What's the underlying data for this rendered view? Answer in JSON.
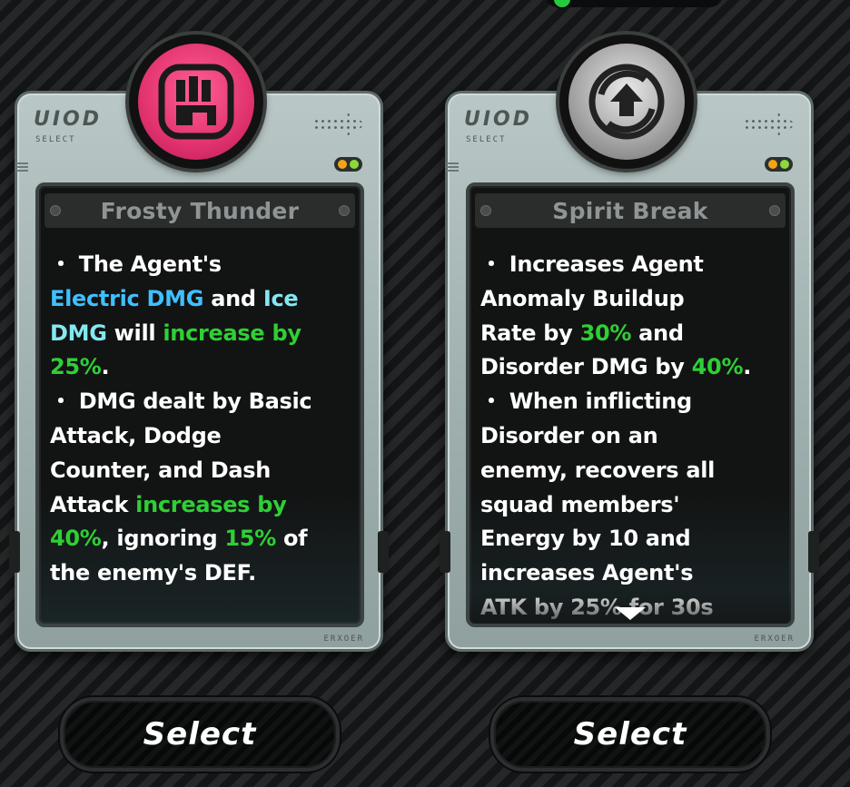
{
  "cards": [
    {
      "brand": "UIOD",
      "brand_sub": "SELECT",
      "foot_code": "ERXOER",
      "icon": "pink-fist-emblem-icon",
      "title": "Frosty Thunder",
      "lines": [
        [
          {
            "t": "・ The Agent's",
            "c": "white"
          }
        ],
        [
          {
            "t": "Electric DMG",
            "c": "blue"
          },
          {
            "t": " and ",
            "c": "white"
          },
          {
            "t": "Ice",
            "c": "ice"
          }
        ],
        [
          {
            "t": "DMG",
            "c": "ice"
          },
          {
            "t": " will ",
            "c": "white"
          },
          {
            "t": "increase by",
            "c": "green"
          }
        ],
        [
          {
            "t": "25%",
            "c": "green"
          },
          {
            "t": ".",
            "c": "white"
          }
        ],
        [
          {
            "t": "・ DMG dealt by Basic",
            "c": "white"
          }
        ],
        [
          {
            "t": "Attack, Dodge",
            "c": "white"
          }
        ],
        [
          {
            "t": "Counter, and Dash",
            "c": "white"
          }
        ],
        [
          {
            "t": "Attack ",
            "c": "white"
          },
          {
            "t": "increases by",
            "c": "green"
          }
        ],
        [
          {
            "t": "40%",
            "c": "green"
          },
          {
            "t": ", ignoring ",
            "c": "white"
          },
          {
            "t": "15%",
            "c": "green"
          },
          {
            "t": " of",
            "c": "white"
          }
        ],
        [
          {
            "t": "the enemy's DEF.",
            "c": "white"
          }
        ]
      ]
    },
    {
      "brand": "UIOD",
      "brand_sub": "SELECT",
      "foot_code": "ERXOER",
      "icon": "silver-upgrade-arrow-emblem-icon",
      "title": "Spirit Break",
      "lines": [
        [
          {
            "t": "・ Increases Agent",
            "c": "white"
          }
        ],
        [
          {
            "t": "Anomaly Buildup",
            "c": "white"
          }
        ],
        [
          {
            "t": "Rate by ",
            "c": "white"
          },
          {
            "t": "30%",
            "c": "green"
          },
          {
            "t": " and",
            "c": "white"
          }
        ],
        [
          {
            "t": "Disorder DMG by ",
            "c": "white"
          },
          {
            "t": "40%",
            "c": "green"
          },
          {
            "t": ".",
            "c": "white"
          }
        ],
        [
          {
            "t": "・ When inflicting",
            "c": "white"
          }
        ],
        [
          {
            "t": "Disorder on an",
            "c": "white"
          }
        ],
        [
          {
            "t": "enemy, recovers all",
            "c": "white"
          }
        ],
        [
          {
            "t": "squad members'",
            "c": "white"
          }
        ],
        [
          {
            "t": "Energy by 10 and",
            "c": "white"
          }
        ],
        [
          {
            "t": "increases Agent's",
            "c": "white"
          }
        ],
        [
          {
            "t": "ATK by 25% for 30s",
            "c": "white"
          }
        ]
      ]
    }
  ],
  "buttons": [
    {
      "label": "Select"
    },
    {
      "label": "Select"
    }
  ],
  "colors": {
    "blue": "#3fc0ff",
    "ice": "#83e8f0",
    "green": "#2fcf35",
    "badge_pink": "#e2336f",
    "led_orange": "#f5a316",
    "led_green": "#8bd93b"
  }
}
